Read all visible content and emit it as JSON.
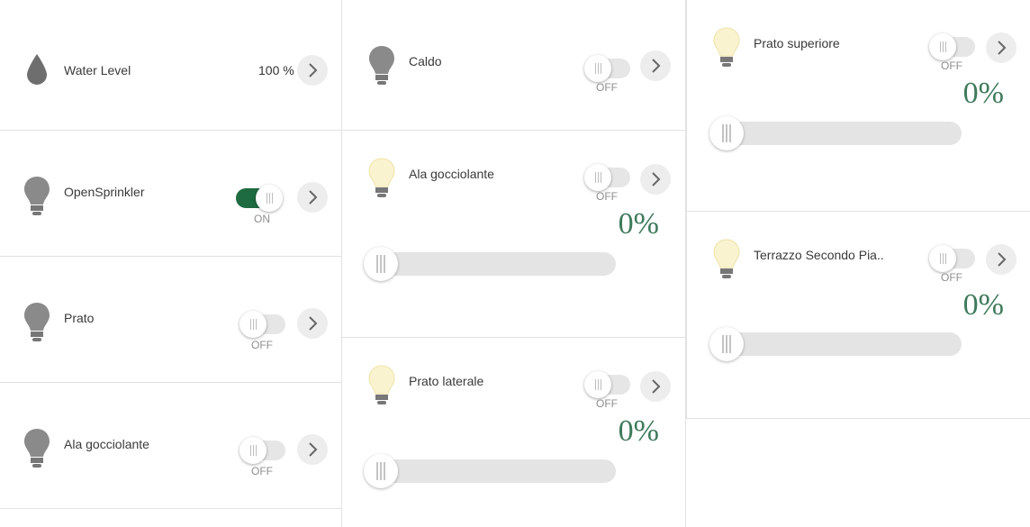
{
  "col1": {
    "water": {
      "title": "Water Level",
      "value": "100 %"
    },
    "opensprinkler": {
      "title": "OpenSprinkler",
      "state": "ON"
    },
    "prato": {
      "title": "Prato",
      "state": "OFF"
    },
    "ala": {
      "title": "Ala gocciolante",
      "state": "OFF"
    }
  },
  "col2": {
    "caldo": {
      "title": "Caldo",
      "state": "OFF"
    },
    "ala": {
      "title": "Ala gocciolante",
      "state": "OFF",
      "percent": "0%"
    },
    "laterale": {
      "title": "Prato laterale",
      "state": "OFF",
      "percent": "0%"
    }
  },
  "col3": {
    "superiore": {
      "title": "Prato superiore",
      "state": "OFF",
      "percent": "0%"
    },
    "terrazzo": {
      "title": "Terrazzo Secondo Pia..",
      "state": "OFF",
      "percent": "0%"
    }
  },
  "colors": {
    "accent_on": "#1e6b41",
    "percent_text": "#3f7a5c",
    "bulb_off": "#8a8a8a",
    "bulb_dim": "#faf3d0"
  },
  "icons": {
    "drop": "water-drop-icon",
    "bulb": "light-bulb-icon",
    "chevron": "chevron-right-icon"
  }
}
